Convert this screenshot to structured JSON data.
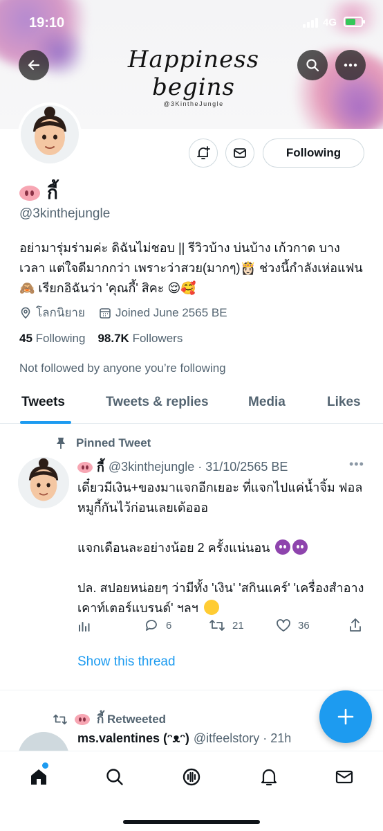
{
  "status_bar": {
    "time": "19:10",
    "network": "4G"
  },
  "banner": {
    "script_text": "Happiness begins",
    "handle_text": "@3KintheJungle"
  },
  "profile": {
    "display_name": "กี้",
    "handle": "@3kinthejungle",
    "bio": "อย่ามารุ่มร่ามค่ะ ดิฉันไม่ชอบ || รีวิวบ้าง บ่นบ้าง เก้วกาด บางเวลา แต่ใจดีมากกว่า เพราะว่าสวย(มากๆ)👸🏻 ช่วงนี้กำลังเห่อแฟน 🙈 เรียกอิฉันว่า 'คุณกี้' สิคะ 😌🥰",
    "location": "โลกนิยาย",
    "joined": "Joined June 2565 BE",
    "following_count": "45",
    "following_label": "Following",
    "followers_count": "98.7K",
    "followers_label": "Followers",
    "not_followed_text": "Not followed by anyone you’re following",
    "follow_button_label": "Following"
  },
  "tabs": [
    {
      "label": "Tweets",
      "active": true
    },
    {
      "label": "Tweets & replies",
      "active": false
    },
    {
      "label": "Media",
      "active": false
    },
    {
      "label": "Likes",
      "active": false
    }
  ],
  "pinned_tweet": {
    "pinned_label": "Pinned Tweet",
    "name": "กี้",
    "handle_date": "@3kinthejungle · 31/10/2565 BE",
    "paragraphs": [
      "เดี๋ยวมีเงิน+ของมาแจกอีกเยอะ ที่แจกไปแค่น้ำจิ้ม ฟอลหมูกี้กันไว้ก่อนเลยเด้อออ",
      "แจกเดือนละอย่างน้อย 2 ครั้งแน่นอน",
      "ปล. สปอยหน่อยๆ ว่ามีทั้ง 'เงิน' 'สกินแคร์' 'เครื่องสำอางเคาท์เตอร์แบรนด์' ฯลฯ"
    ],
    "replies": "6",
    "retweets": "21",
    "likes": "36",
    "show_thread": "Show this thread"
  },
  "retweet": {
    "retweeted_label": "กี้ Retweeted",
    "name": "ms.valentines (ᵔᴥᵔ)",
    "handle_time": "@itfeelstory · 21h"
  },
  "colors": {
    "accent": "#1d9bf0",
    "text": "#0f1419",
    "muted": "#536471"
  },
  "icons": [
    "back-arrow-icon",
    "search-icon",
    "more-icon",
    "notification-add-icon",
    "mail-icon",
    "location-icon",
    "calendar-icon",
    "pin-icon",
    "analytics-icon",
    "reply-icon",
    "retweet-icon",
    "like-icon",
    "share-icon",
    "compose-plus-icon",
    "home-icon",
    "explore-icon",
    "spaces-icon",
    "bell-icon",
    "messages-icon"
  ]
}
